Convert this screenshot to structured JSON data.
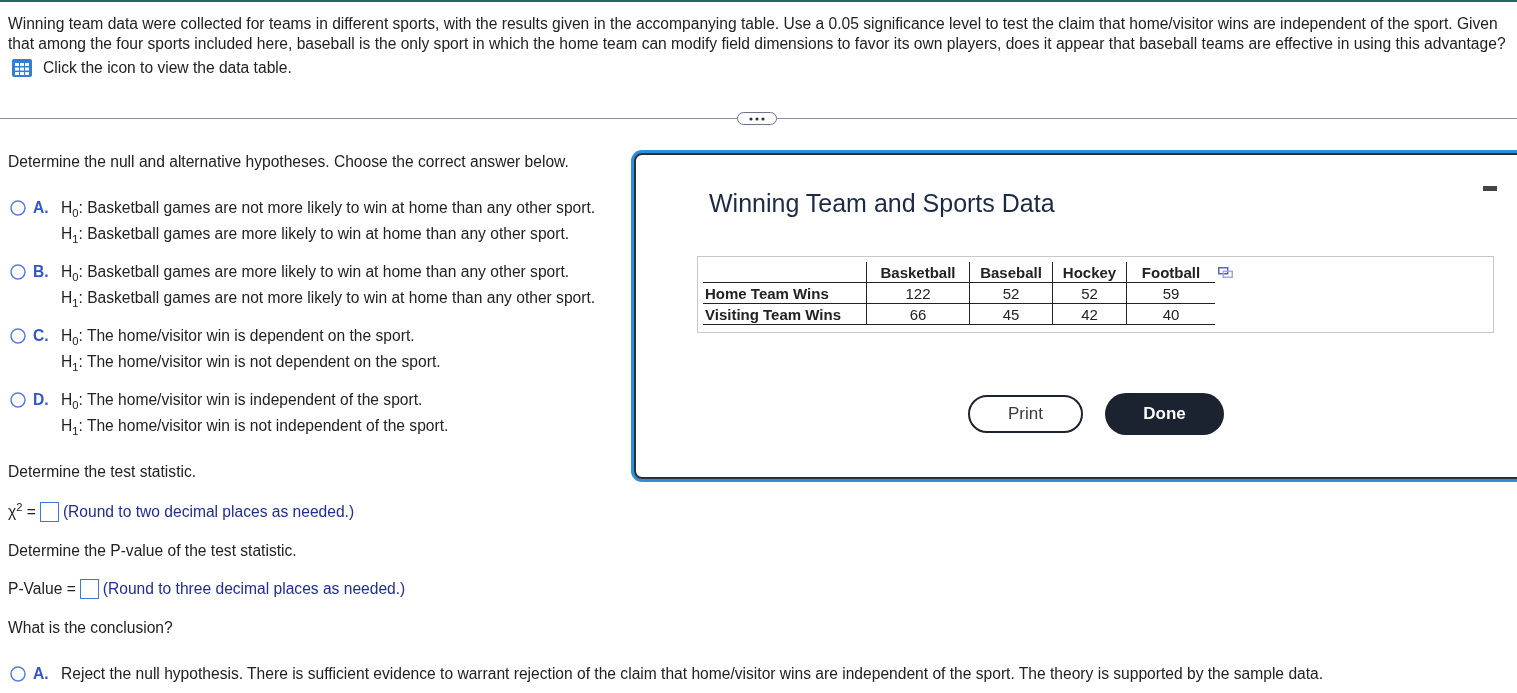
{
  "question": {
    "text": "Winning team data were collected for teams in different sports, with the results given in the accompanying table. Use a 0.05 significance level to test the claim that home/visitor wins are independent of the sport. Given that among the four sports included here, baseball is the only sport in which the home team can modify field dimensions to favor its own players, does it appear that baseball teams are effective in using this advantage?",
    "data_link": "Click the icon to view the data table."
  },
  "hypotheses": {
    "prompt": "Determine the null and alternative hypotheses. Choose the correct answer below.",
    "options": [
      {
        "letter": "A.",
        "lines": [
          "H$_{0}$: Basketball games are not more likely to win at home than any other sport.",
          "H$_{1}$: Basketball games are more likely to win at home than any other sport."
        ],
        "selected": false
      },
      {
        "letter": "B.",
        "lines": [
          "H$_{0}$: Basketball games are more likely to win at home than any other sport.",
          "H$_{1}$: Basketball games are not more likely to win at home than any other sport."
        ],
        "selected": false
      },
      {
        "letter": "C.",
        "lines": [
          "H$_{0}$: The home/visitor win is dependent on the sport.",
          "H$_{1}$: The home/visitor win is not dependent on the sport."
        ],
        "selected": false
      },
      {
        "letter": "D.",
        "lines": [
          "H$_{0}$: The home/visitor win is independent of the sport.",
          "H$_{1}$: The home/visitor win is not independent of the sport."
        ],
        "selected": false
      }
    ]
  },
  "statistic": {
    "prompt": "Determine the test statistic.",
    "label": "χ$^{2}$ =",
    "hint": "(Round to two decimal places as needed.)"
  },
  "p_value": {
    "prompt": "Determine the P-value of the test statistic.",
    "label": "P-Value =",
    "hint": "(Round to three decimal places as needed.)"
  },
  "conclusion": {
    "prompt": "What is the conclusion?",
    "options": [
      {
        "letter": "A.",
        "text": "Reject the null hypothesis. There is sufficient evidence to warrant rejection of the claim that home/visitor wins are independent of the sport. The theory is supported by the sample data.",
        "selected": false
      }
    ]
  },
  "dialog": {
    "title": "Winning Team and Sports Data",
    "table": {
      "columns": [
        "Basketball",
        "Baseball",
        "Hockey",
        "Football"
      ],
      "rows": [
        {
          "label": "Home Team Wins",
          "cells": [
            "122",
            "52",
            "52",
            "59"
          ]
        },
        {
          "label": "Visiting Team Wins",
          "cells": [
            "66",
            "45",
            "42",
            "40"
          ]
        }
      ]
    },
    "buttons": [
      {
        "label": "Print",
        "kind": "secondary"
      },
      {
        "label": "Done",
        "kind": "primary"
      }
    ]
  }
}
